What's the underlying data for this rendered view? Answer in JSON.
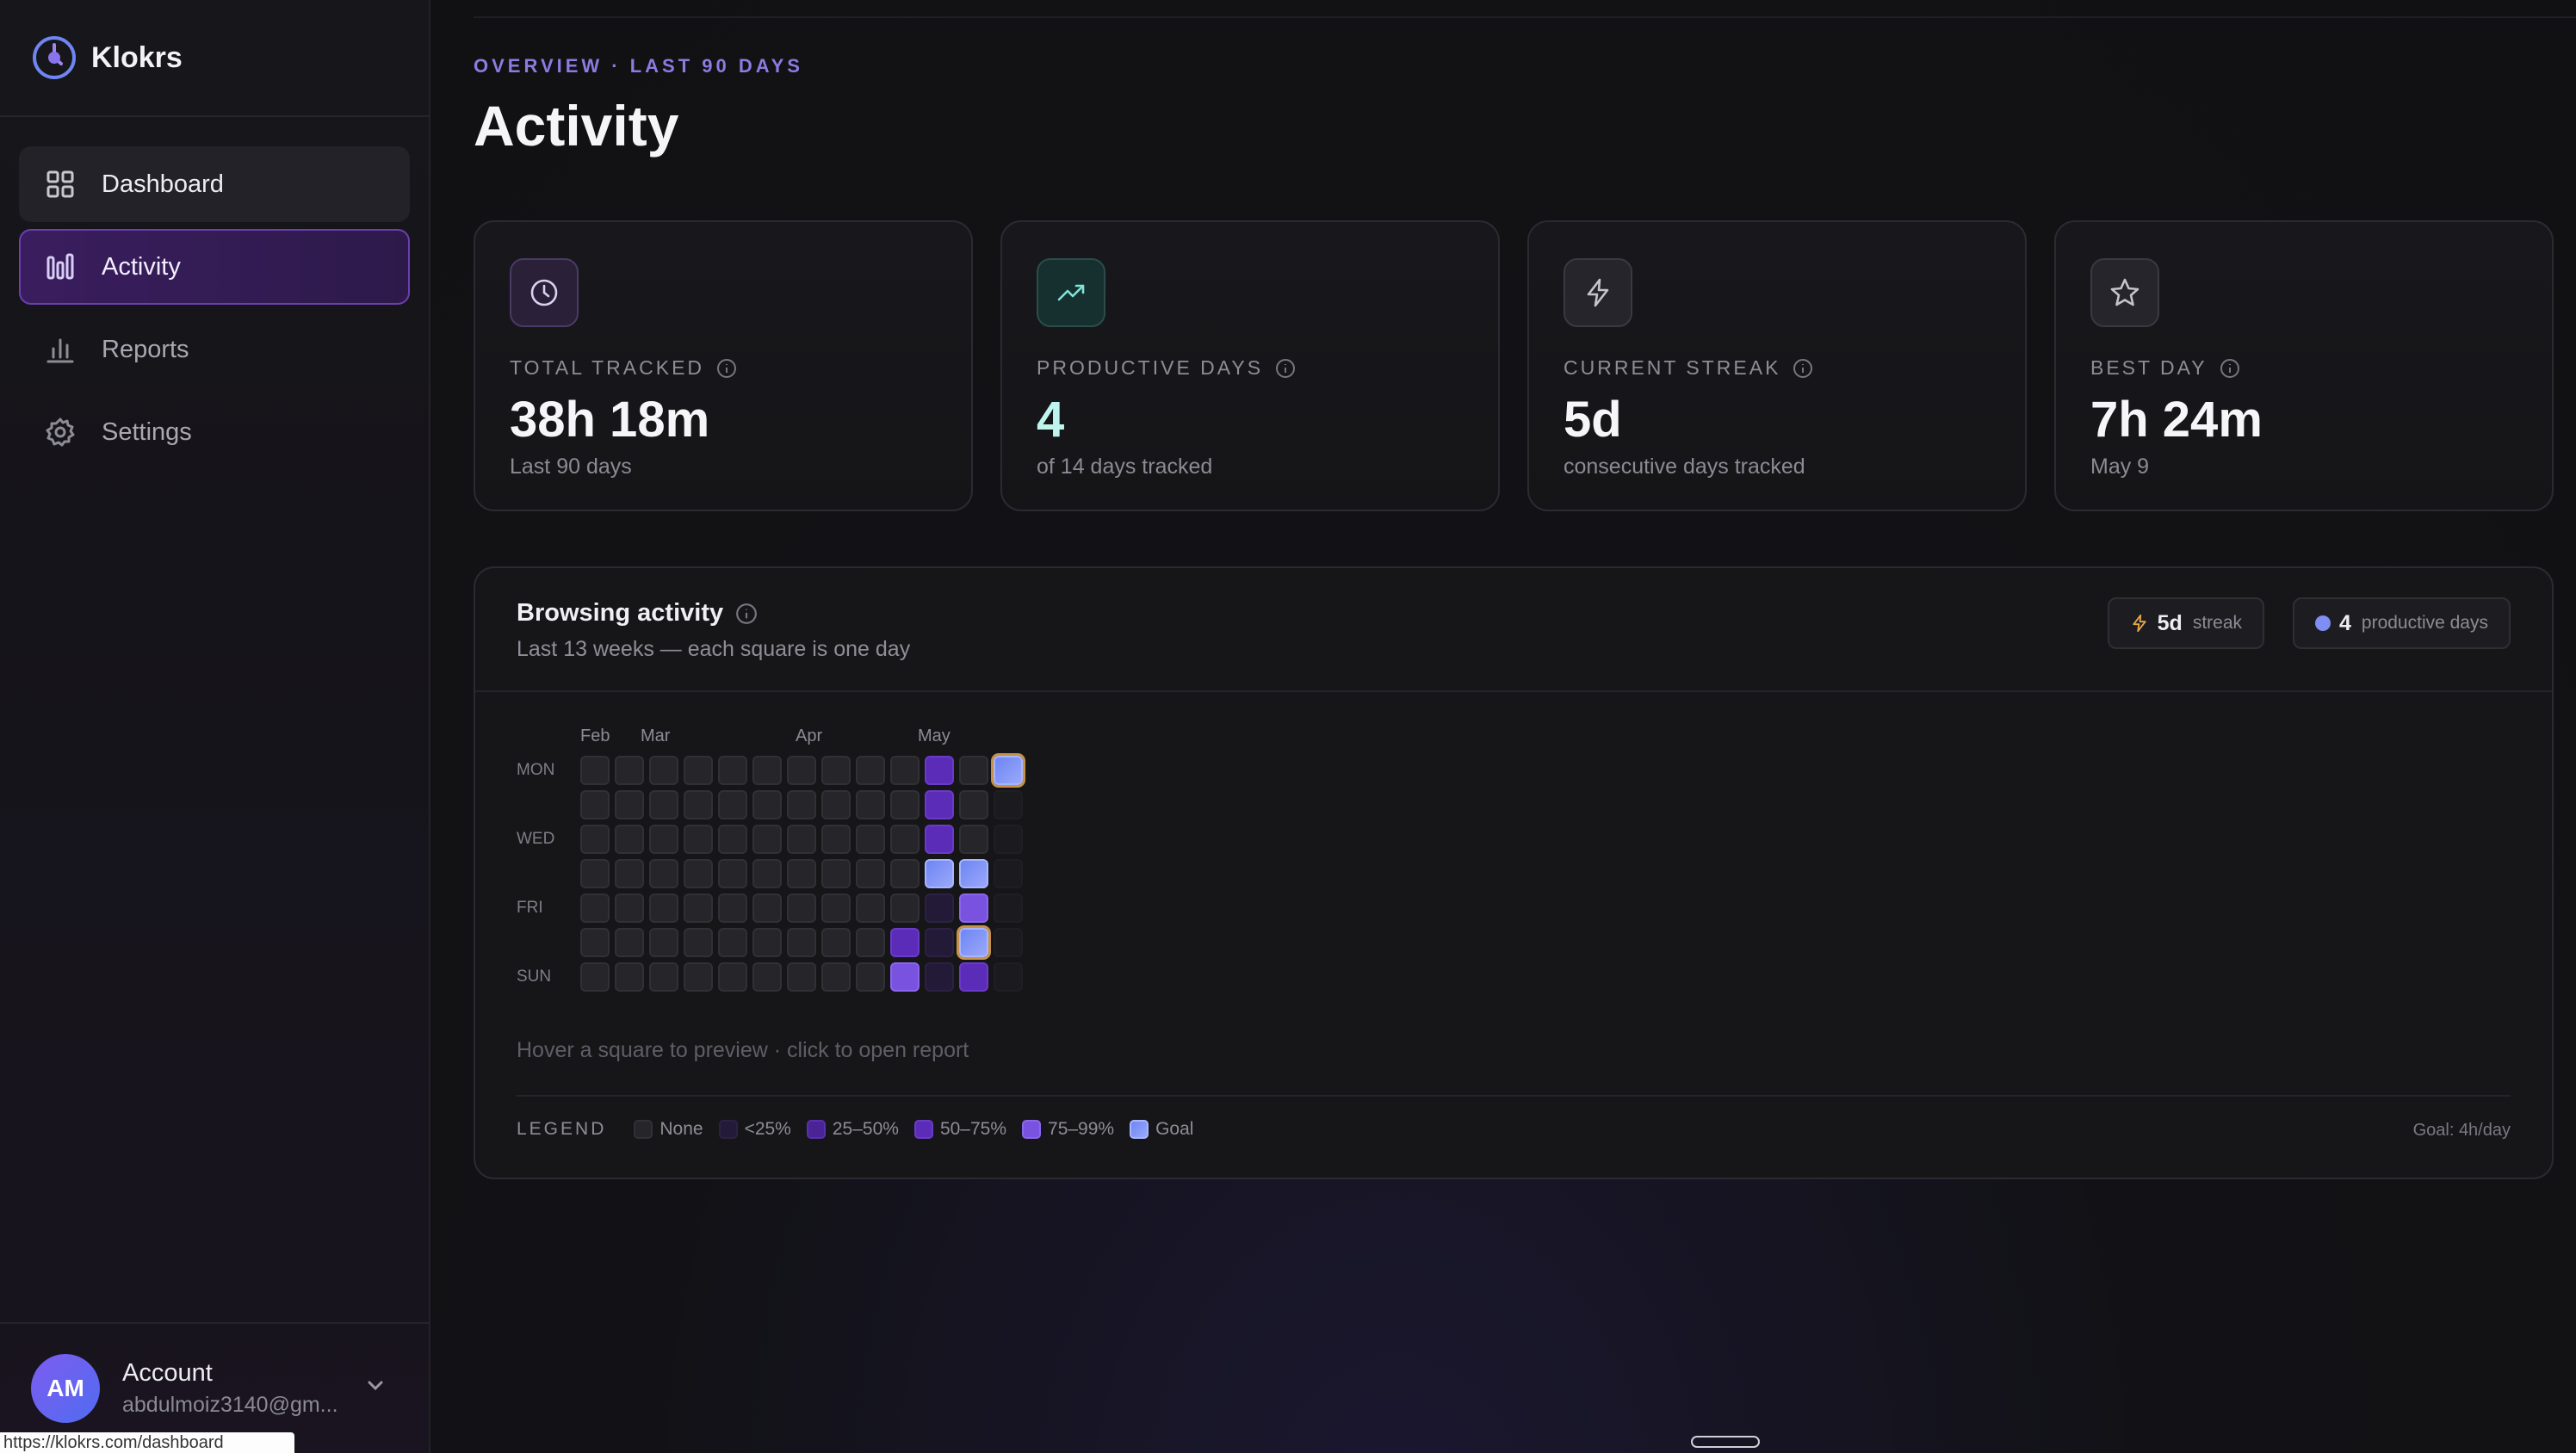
{
  "app": {
    "name": "Klokrs",
    "status_url": "https://klokrs.com/dashboard"
  },
  "sidebar": {
    "items": [
      {
        "label": "Dashboard",
        "icon": "grid-icon",
        "state": "hover"
      },
      {
        "label": "Activity",
        "icon": "activity-bars-icon",
        "state": "active"
      },
      {
        "label": "Reports",
        "icon": "bar-chart-icon",
        "state": "default"
      },
      {
        "label": "Settings",
        "icon": "gear-icon",
        "state": "default"
      }
    ]
  },
  "account": {
    "initials": "AM",
    "name": "Account",
    "email": "abdulmoiz3140@gm..."
  },
  "header": {
    "eyebrow": "OVERVIEW · LAST 90 DAYS",
    "title": "Activity"
  },
  "stats": [
    {
      "label": "TOTAL TRACKED",
      "value": "38h 18m",
      "sub": "Last 90 days",
      "icon": "clock-icon"
    },
    {
      "label": "PRODUCTIVE DAYS",
      "value": "4",
      "sub": "of 14 days tracked",
      "icon": "trend-up-icon"
    },
    {
      "label": "CURRENT STREAK",
      "value": "5d",
      "sub": "consecutive days tracked",
      "icon": "lightning-icon"
    },
    {
      "label": "BEST DAY",
      "value": "7h 24m",
      "sub": "May 9",
      "icon": "star-icon"
    }
  ],
  "panel": {
    "title": "Browsing activity",
    "subtitle": "Last 13 weeks — each square is one day",
    "streak_chip": {
      "value": "5d",
      "label": "streak"
    },
    "productive_chip": {
      "value": "4",
      "label": "productive days"
    },
    "months": [
      "Feb",
      "Mar",
      "Apr",
      "May"
    ],
    "day_labels": [
      "MON",
      "",
      "WED",
      "",
      "FRI",
      "",
      "SUN"
    ],
    "hint": "Hover a square to preview · click to open report",
    "legend": {
      "title": "LEGEND",
      "items": [
        "None",
        "<25%",
        "25–50%",
        "50–75%",
        "75–99%",
        "Goal"
      ]
    },
    "goal_text": "Goal: 4h/day"
  },
  "heatmap_levels": [
    [
      "l0",
      "l0",
      "l0",
      "l0",
      "l0",
      "l0",
      "l0"
    ],
    [
      "l0",
      "l0",
      "l0",
      "l0",
      "l0",
      "l0",
      "l0"
    ],
    [
      "l0",
      "l0",
      "l0",
      "l0",
      "l0",
      "l0",
      "l0"
    ],
    [
      "l0",
      "l0",
      "l0",
      "l0",
      "l0",
      "l0",
      "l0"
    ],
    [
      "l0",
      "l0",
      "l0",
      "l0",
      "l0",
      "l0",
      "l0"
    ],
    [
      "l0",
      "l0",
      "l0",
      "l0",
      "l0",
      "l0",
      "l0"
    ],
    [
      "l0",
      "l0",
      "l0",
      "l0",
      "l0",
      "l0",
      "l0"
    ],
    [
      "l0",
      "l0",
      "l0",
      "l0",
      "l0",
      "l0",
      "l0"
    ],
    [
      "l0",
      "l0",
      "l0",
      "l0",
      "l0",
      "l0",
      "l0"
    ],
    [
      "l0",
      "l0",
      "l0",
      "l0",
      "l0",
      "l3",
      "l4"
    ],
    [
      "l3",
      "l3",
      "l3",
      "goal",
      "l1",
      "l1",
      "l1"
    ],
    [
      "l0",
      "l0",
      "l0",
      "goal",
      "l4",
      "goal",
      "l3"
    ],
    [
      "goal",
      "empty",
      "empty",
      "empty",
      "empty",
      "empty",
      "empty"
    ]
  ],
  "colors": {
    "accent": "#6c3fb0",
    "eyebrow": "#8d7be0",
    "goal": "#7f8ef2",
    "streak": "#e8a64a"
  }
}
